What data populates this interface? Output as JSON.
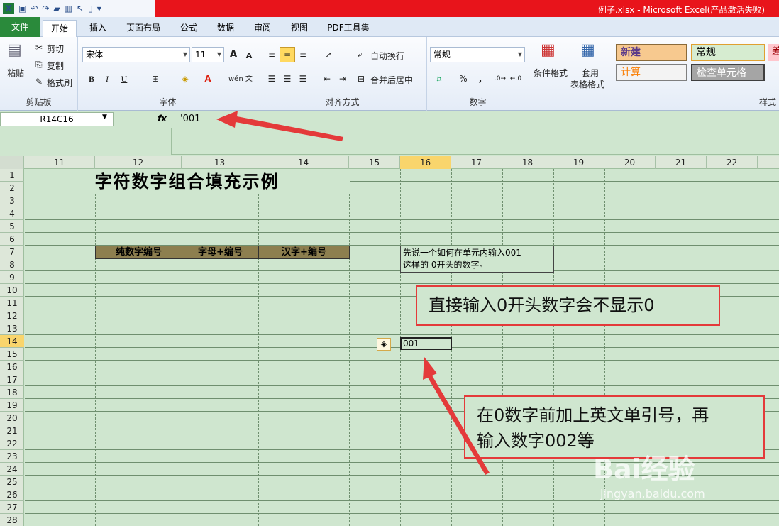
{
  "titlebar": {
    "title": "例子.xlsx - Microsoft Excel(产品激活失败)"
  },
  "tabs": [
    "文件",
    "开始",
    "插入",
    "页面布局",
    "公式",
    "数据",
    "审阅",
    "视图",
    "PDF工具集"
  ],
  "ribbon": {
    "clipboard": {
      "paste": "粘贴",
      "cut": "剪切",
      "copy": "复制",
      "format_painter": "格式刷",
      "label": "剪贴板"
    },
    "font": {
      "name": "宋体",
      "size": "11",
      "label": "字体",
      "bold": "B",
      "italic": "I",
      "underline": "U",
      "grow": "A",
      "shrink": "A",
      "wen": "wén 文"
    },
    "alignment": {
      "wrap": "自动换行",
      "merge": "合并后居中",
      "label": "对齐方式"
    },
    "number": {
      "format": "常规",
      "percent": "%",
      "comma": ",",
      "label": "数字"
    },
    "styles": {
      "conditional": "条件格式",
      "table_line1": "套用",
      "table_line2": "表格格式",
      "new": "新建",
      "normal": "常规",
      "bad": "差",
      "calc": "计算",
      "check": "检查单元格",
      "label": "样式"
    }
  },
  "formula_bar": {
    "name_box": "R14C16",
    "fx": "fx",
    "formula": "'001"
  },
  "grid": {
    "columns": [
      "11",
      "12",
      "13",
      "14",
      "15",
      "16",
      "17",
      "18",
      "19",
      "20",
      "21",
      "22"
    ],
    "selected_column": "16",
    "rows": [
      "1",
      "2",
      "3",
      "4",
      "5",
      "6",
      "7",
      "8",
      "9",
      "10",
      "11",
      "12",
      "13",
      "14",
      "15",
      "16",
      "17",
      "18",
      "19",
      "20",
      "21",
      "22",
      "23",
      "24",
      "25",
      "26",
      "27",
      "28"
    ],
    "selected_row": "14"
  },
  "sheet": {
    "title": "字符数字组合填充示例",
    "headers": [
      "纯数字编号",
      "字母+编号",
      "汉字+编号"
    ],
    "note_line1": "先说一个如何在单元内输入001",
    "note_line2": "这样的 0开头的数字。",
    "active_value": "001",
    "error_icon": "◈"
  },
  "callouts": {
    "first": "直接输入0开头数字会不显示0",
    "second_line1": "在0数字前加上英文单引号，再",
    "second_line2": "输入数字002等"
  },
  "watermark": {
    "brand": "Bai经验",
    "url": "jingyan.baidu.com"
  },
  "colors": {
    "accent_red": "#e8141b",
    "file_tab": "#2a8a3b",
    "sheet_bg": "#cfe6cf",
    "header_fill": "#8d7f4f",
    "callout_border": "#e43a3a"
  }
}
